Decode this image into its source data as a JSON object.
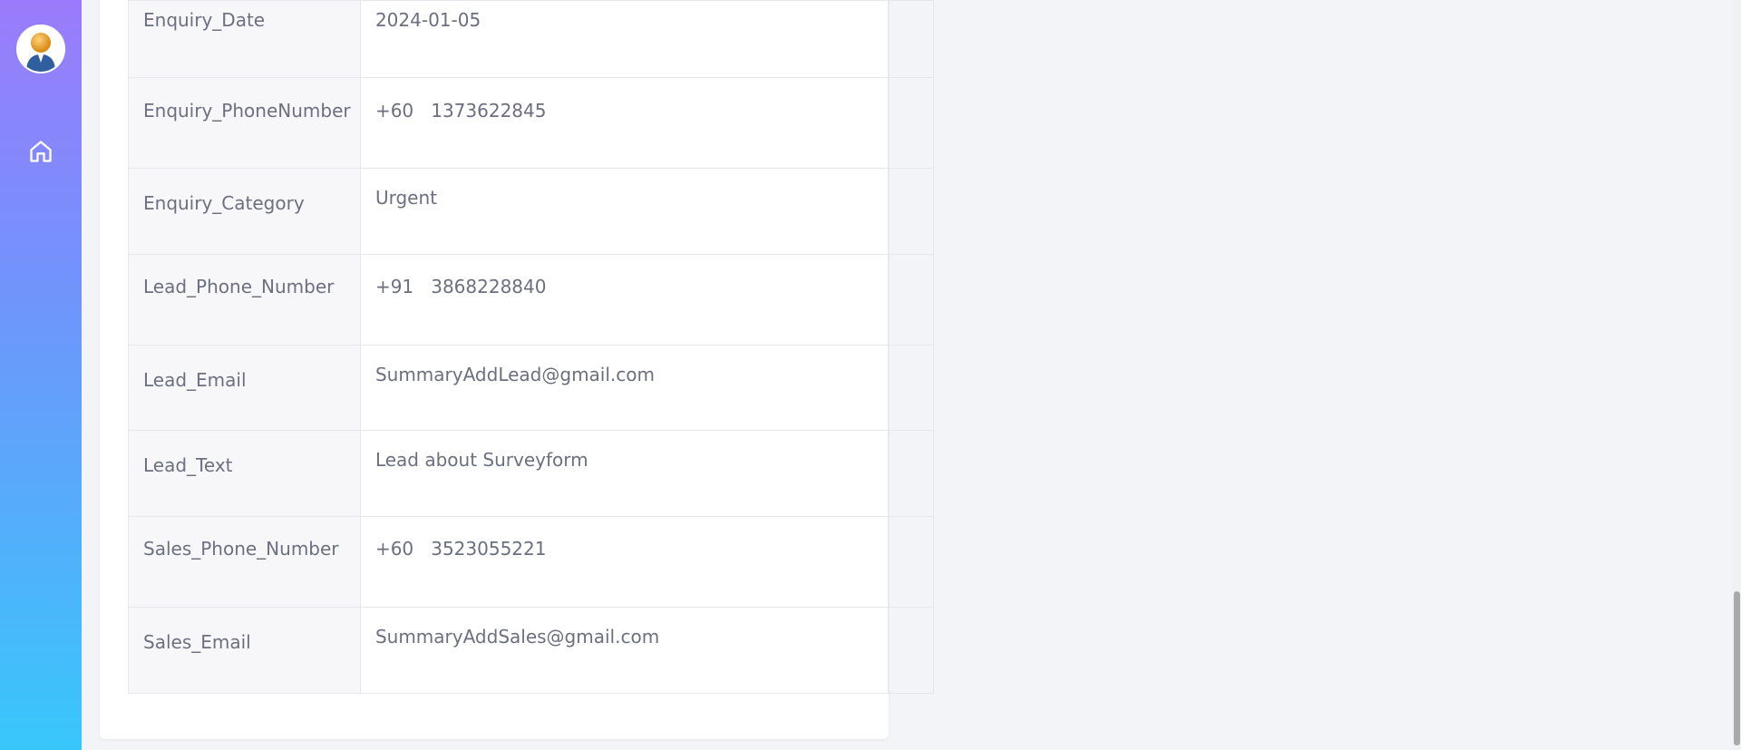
{
  "sidebar": {
    "avatar_icon": "user-avatar-icon",
    "home_icon": "home-icon"
  },
  "details": {
    "rows": [
      {
        "label": "Enquiry_Date",
        "value": "2024-01-05"
      },
      {
        "label": "Enquiry_PhoneNumber",
        "value": "+60   1373622845"
      },
      {
        "label": "Enquiry_Category",
        "value": "Urgent"
      },
      {
        "label": "Lead_Phone_Number",
        "value": "+91   3868228840"
      },
      {
        "label": "Lead_Email",
        "value": "SummaryAddLead@gmail.com"
      },
      {
        "label": "Lead_Text",
        "value": "Lead about Surveyform"
      },
      {
        "label": "Sales_Phone_Number",
        "value": "+60   3523055221"
      },
      {
        "label": "Sales_Email",
        "value": "SummaryAddSales@gmail.com"
      }
    ]
  },
  "colors": {
    "sidebar_top": "#9b7bfb",
    "sidebar_bottom": "#38c7fb",
    "page_bg": "#f3f4f8",
    "text": "#6b6f80"
  }
}
